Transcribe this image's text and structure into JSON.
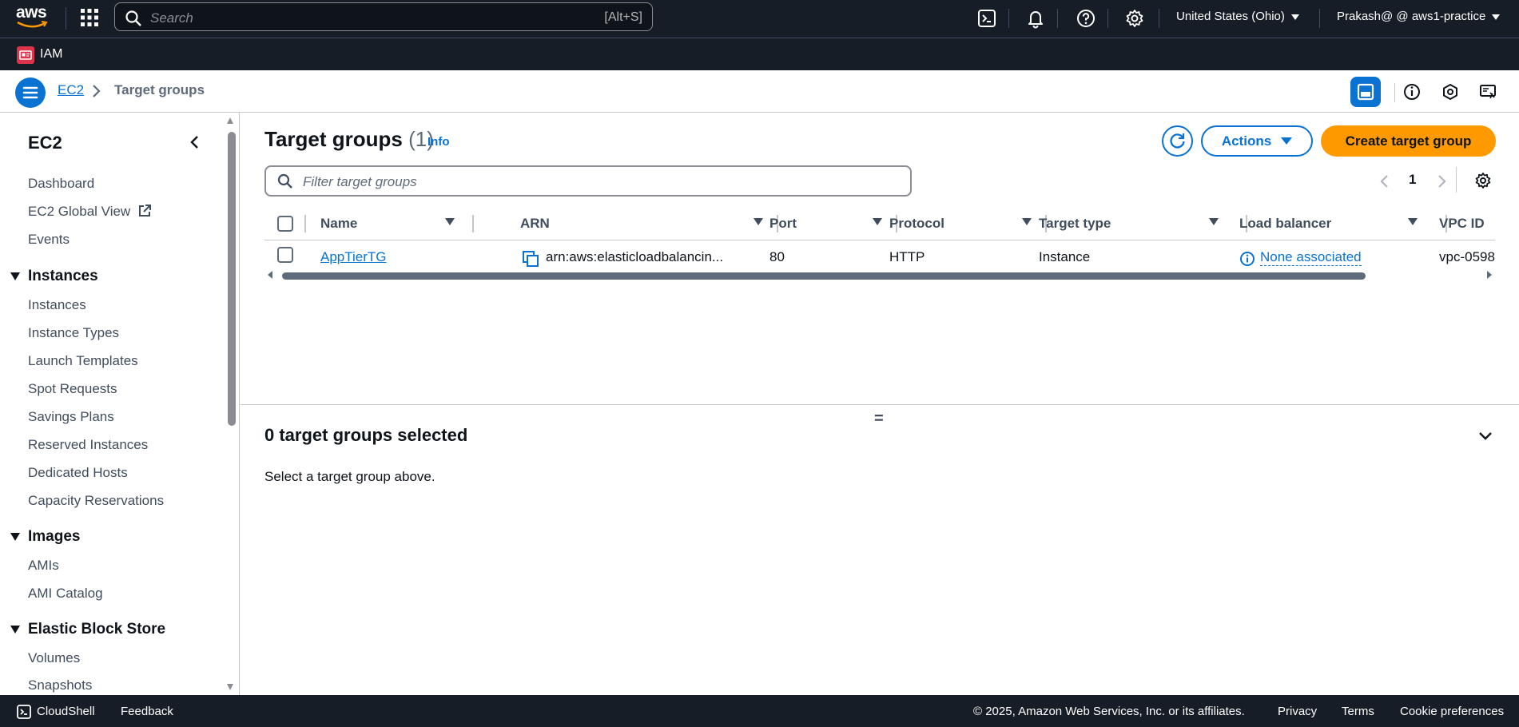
{
  "topbar": {
    "logo_text": "aws",
    "search_placeholder": "Search",
    "search_shortcut": "[Alt+S]",
    "region": "United States (Ohio)",
    "account": "Prakash@ @ aws1-practice",
    "icons": [
      "apps-grid-icon",
      "cloudshell-icon",
      "bell-icon",
      "help-icon",
      "settings-icon"
    ]
  },
  "service_bar": {
    "label": "IAM"
  },
  "breadcrumb": {
    "items": [
      "EC2",
      "Target groups"
    ]
  },
  "sidenav": {
    "title": "EC2",
    "items_top": [
      "Dashboard",
      "EC2 Global View",
      "Events"
    ],
    "sections": [
      {
        "title": "Instances",
        "items": [
          "Instances",
          "Instance Types",
          "Launch Templates",
          "Spot Requests",
          "Savings Plans",
          "Reserved Instances",
          "Dedicated Hosts",
          "Capacity Reservations"
        ]
      },
      {
        "title": "Images",
        "items": [
          "AMIs",
          "AMI Catalog"
        ]
      },
      {
        "title": "Elastic Block Store",
        "items": [
          "Volumes",
          "Snapshots"
        ]
      }
    ]
  },
  "main": {
    "title": "Target groups",
    "count": "(1)",
    "info": "Info",
    "actions_label": "Actions",
    "create_label": "Create target group",
    "filter_placeholder": "Filter target groups",
    "page_number": "1",
    "columns": [
      "Name",
      "ARN",
      "Port",
      "Protocol",
      "Target type",
      "Load balancer",
      "VPC ID"
    ],
    "rows": [
      {
        "name": "AppTierTG",
        "arn": "arn:aws:elasticloadbalancin...",
        "port": "80",
        "protocol": "HTTP",
        "target_type": "Instance",
        "load_balancer": "None associated",
        "vpc_id": "vpc-0598"
      }
    ],
    "split_handle": "=",
    "selection_title": "0 target groups selected",
    "selection_message": "Select a target group above."
  },
  "footer": {
    "cloudshell": "CloudShell",
    "feedback": "Feedback",
    "copyright": "© 2025, Amazon Web Services, Inc. or its affiliates.",
    "privacy": "Privacy",
    "terms": "Terms",
    "cookies": "Cookie preferences"
  },
  "colors": {
    "nav_dark": "#161d26",
    "link_blue": "#0972d3",
    "primary_orange": "#ff9900",
    "iam_red": "#dd344c"
  }
}
